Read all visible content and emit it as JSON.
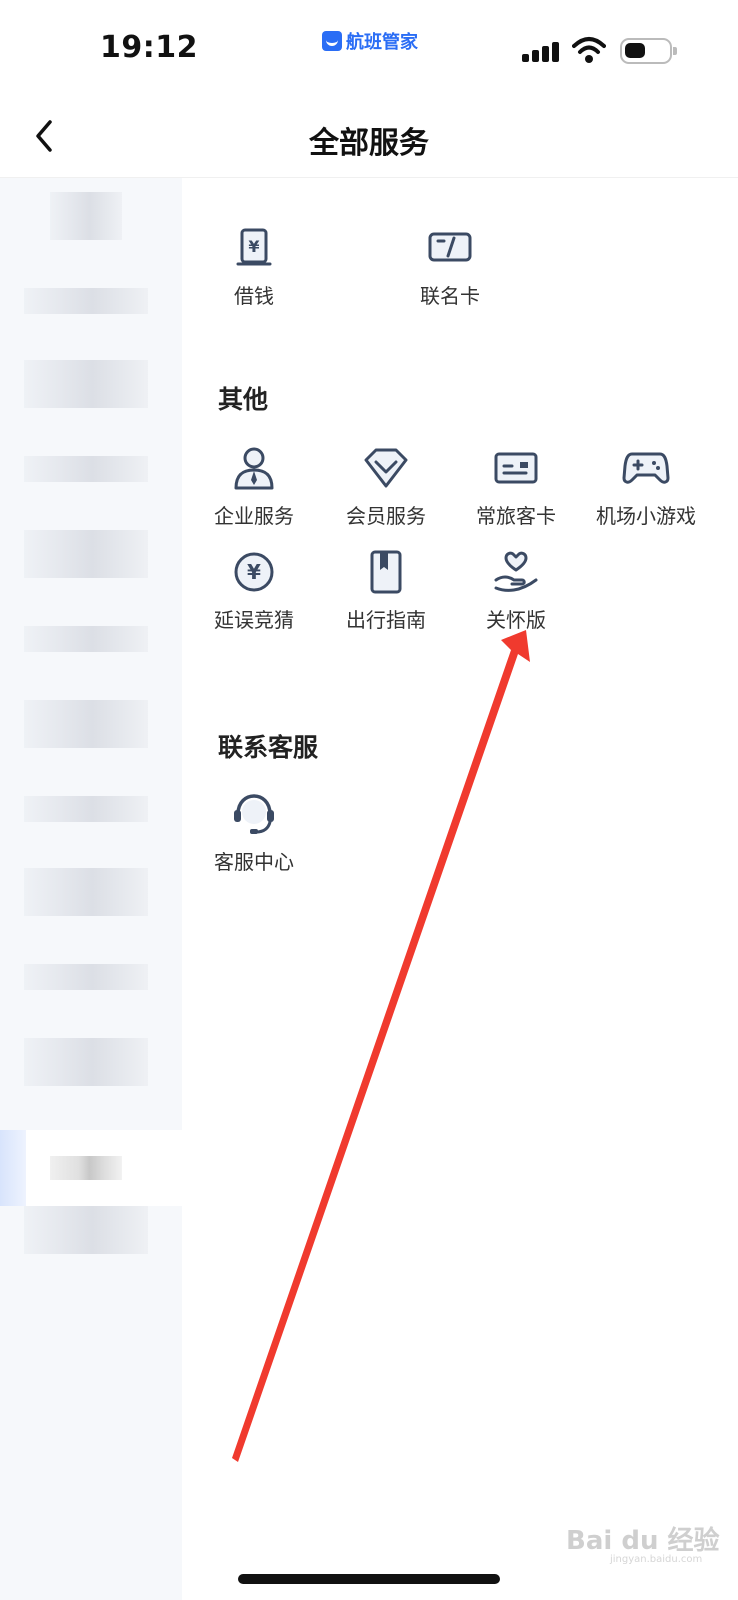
{
  "status_bar": {
    "time": "19:12",
    "app_name": "航班管家"
  },
  "nav": {
    "title": "全部服务"
  },
  "services_top": [
    {
      "label": "借钱",
      "icon": "bill-yen-icon"
    },
    {
      "label": "联名卡",
      "icon": "card-icon"
    }
  ],
  "section_other": {
    "title": "其他",
    "items": [
      {
        "label": "企业服务",
        "icon": "business-person-icon"
      },
      {
        "label": "会员服务",
        "icon": "diamond-icon"
      },
      {
        "label": "常旅客卡",
        "icon": "member-card-icon"
      },
      {
        "label": "机场小游戏",
        "icon": "gamepad-icon"
      },
      {
        "label": "延误竞猜",
        "icon": "yen-coin-icon"
      },
      {
        "label": "出行指南",
        "icon": "guide-book-icon"
      },
      {
        "label": "关怀版",
        "icon": "heart-hand-icon"
      }
    ]
  },
  "section_contact": {
    "title": "联系客服",
    "items": [
      {
        "label": "客服中心",
        "icon": "headset-icon"
      }
    ]
  },
  "watermark": {
    "brand": "Bai du 经验",
    "url": "jingyan.baidu.com"
  },
  "colors": {
    "accent": "#2a6df5",
    "icon": "#3b4a63",
    "sidebar_bg": "#f6f8fb",
    "arrow": "#f03a2e"
  }
}
